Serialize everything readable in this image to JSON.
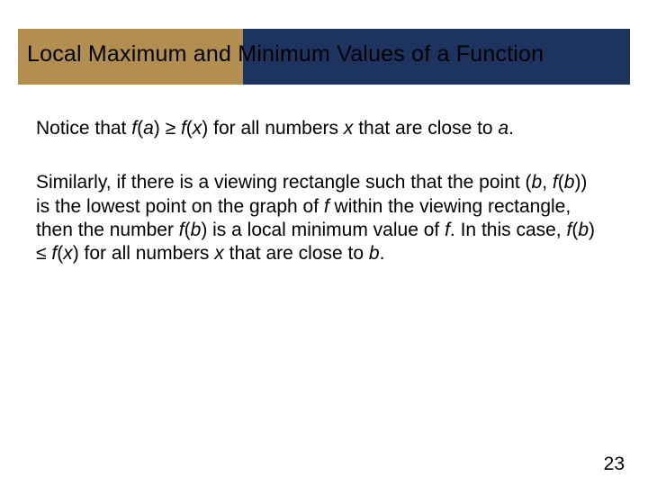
{
  "title": "Local Maximum and Minimum Values of a Function",
  "para1": {
    "t1": "Notice that ",
    "fa": "f",
    "t2": "(",
    "a1": "a",
    "t3": ") ≥ ",
    "fx": "f",
    "t4": "(",
    "x1": "x",
    "t5": ") for all numbers ",
    "x2": "x",
    "t6": " that are close to ",
    "a2": "a",
    "t7": "."
  },
  "para2": {
    "s1": "Similarly, if there is a viewing rectangle such that the point (",
    "b1": "b",
    "s2": ", ",
    "f1": "f",
    "s3": "(",
    "b2": "b",
    "s4": ")) is the lowest point on the graph of ",
    "f2": "f",
    "s5": " within the viewing rectangle, then the number ",
    "f3": "f",
    "s6": "(",
    "b3": "b",
    "s7": ") is a local minimum value of ",
    "f4": "f",
    "s8": ". In this case, ",
    "f5": "f",
    "s9": "(",
    "b4": "b",
    "s10": ") ≤ ",
    "f6": "f",
    "s11": "(",
    "x3": "x",
    "s12": ") for all numbers ",
    "x4": "x",
    "s13": " that are close to ",
    "b5": "b",
    "s14": "."
  },
  "page": "23"
}
